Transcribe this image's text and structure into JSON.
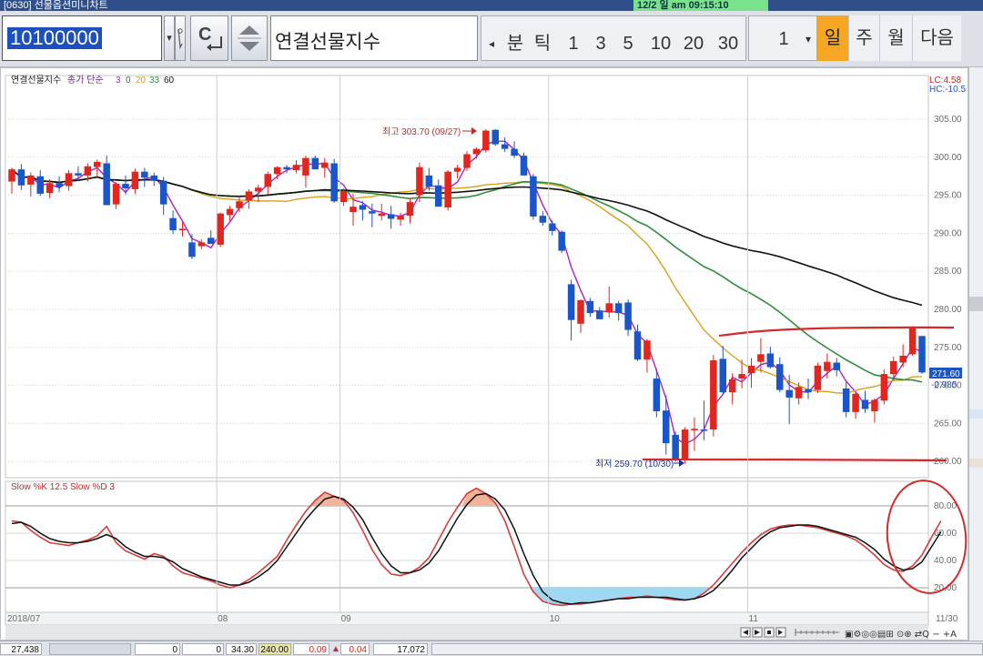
{
  "window": {
    "title": "[0630] 선물옵션미니차트",
    "alert": "12/2 일 am 09:15:10"
  },
  "toolbar": {
    "code": "10100000",
    "name": "연결선물지수",
    "periods": [
      "분",
      "틱",
      "1",
      "3",
      "5",
      "10",
      "20",
      "30"
    ],
    "count": "1",
    "tabs": [
      "일",
      "주",
      "월",
      "다음"
    ],
    "active_tab": "일"
  },
  "chart": {
    "header": {
      "symbol": "연결선물지수",
      "ma_label": "종가 단순",
      "ma_periods": [
        "3",
        "0",
        "20",
        "33",
        "60"
      ]
    },
    "side_info": [
      "LC:4.58",
      "HC:-10.5"
    ],
    "last_price": "271.60",
    "last_change": "-0.985",
    "high_note": "최고 303.70 (09/27)",
    "low_note": "최저 259.70 (10/30)",
    "osc_header": "Slow %K 12.5  Slow %D 3"
  },
  "chart_data": [
    {
      "type": "candlestick",
      "title": "연결선물지수",
      "yticks": [
        305,
        300,
        295,
        290,
        285,
        280,
        275,
        270,
        265,
        260
      ],
      "ylim": [
        259,
        307
      ],
      "x_labels": [
        "2018/07",
        "08",
        "09",
        "10",
        "11",
        "11/30"
      ],
      "ohlc": [
        [
          296.8,
          298.6,
          295.2,
          298.4
        ],
        [
          298.4,
          299.1,
          295.7,
          296.3
        ],
        [
          296.4,
          298.0,
          294.8,
          297.6
        ],
        [
          297.5,
          298.3,
          294.9,
          295.2
        ],
        [
          295.3,
          297.1,
          294.6,
          296.6
        ],
        [
          296.6,
          297.5,
          295.4,
          296.1
        ],
        [
          296.2,
          298.3,
          295.6,
          297.9
        ],
        [
          297.9,
          298.8,
          296.9,
          297.6
        ],
        [
          297.6,
          299.2,
          296.8,
          298.8
        ],
        [
          298.7,
          299.7,
          297.4,
          299.4
        ],
        [
          299.2,
          300.2,
          298.4,
          293.7
        ],
        [
          293.8,
          296.7,
          293.2,
          296.5
        ],
        [
          296.5,
          297.6,
          295.1,
          295.9
        ],
        [
          295.8,
          298.5,
          295.2,
          298.1
        ],
        [
          298.1,
          298.6,
          296.1,
          297.3
        ],
        [
          297.6,
          298.0,
          296.2,
          296.9
        ],
        [
          296.9,
          297.4,
          292.4,
          293.8
        ],
        [
          292.0,
          293.0,
          289.9,
          290.4
        ],
        [
          290.4,
          291.5,
          289.6,
          290.6
        ],
        [
          288.8,
          289.9,
          286.6,
          286.9
        ],
        [
          288.3,
          289.2,
          287.9,
          288.8
        ],
        [
          289.4,
          290.4,
          288.7,
          288.6
        ],
        [
          288.5,
          292.7,
          288.2,
          292.6
        ],
        [
          292.4,
          293.6,
          291.6,
          293.2
        ],
        [
          293.3,
          295.0,
          292.8,
          294.2
        ],
        [
          294.3,
          295.8,
          293.2,
          295.5
        ],
        [
          295.5,
          296.4,
          294.1,
          296.0
        ],
        [
          296.1,
          298.1,
          295.1,
          297.8
        ],
        [
          297.8,
          298.8,
          297.1,
          298.7
        ],
        [
          298.7,
          299.0,
          297.9,
          298.4
        ],
        [
          298.3,
          299.6,
          297.9,
          299.0
        ],
        [
          297.6,
          300.2,
          296.0,
          299.9
        ],
        [
          299.9,
          300.2,
          298.4,
          298.4
        ],
        [
          298.6,
          299.9,
          297.3,
          299.3
        ],
        [
          299.2,
          299.8,
          294.0,
          294.2
        ],
        [
          294.1,
          295.9,
          293.6,
          295.5
        ],
        [
          292.8,
          295.2,
          291.0,
          293.5
        ],
        [
          293.7,
          294.2,
          291.7,
          293.1
        ],
        [
          292.9,
          293.9,
          290.8,
          292.6
        ],
        [
          292.3,
          293.9,
          291.7,
          292.6
        ],
        [
          292.5,
          293.6,
          290.6,
          291.9
        ],
        [
          291.8,
          292.7,
          291.0,
          292.3
        ],
        [
          292.3,
          294.6,
          291.3,
          294.1
        ],
        [
          295.0,
          299.3,
          294.1,
          298.7
        ],
        [
          297.6,
          298.6,
          295.6,
          296.1
        ],
        [
          296.3,
          297.1,
          293.5,
          293.5
        ],
        [
          293.4,
          298.3,
          293.0,
          298.1
        ],
        [
          298.1,
          299.0,
          297.2,
          298.6
        ],
        [
          298.6,
          300.8,
          298.2,
          300.4
        ],
        [
          300.4,
          301.3,
          299.8,
          301.1
        ],
        [
          300.9,
          303.7,
          300.6,
          303.5
        ],
        [
          303.6,
          303.7,
          301.5,
          301.7
        ],
        [
          301.7,
          302.6,
          300.7,
          301.1
        ],
        [
          301.1,
          302.1,
          299.9,
          300.2
        ],
        [
          300.2,
          300.6,
          297.6,
          297.6
        ],
        [
          297.5,
          297.8,
          291.8,
          292.2
        ],
        [
          292.3,
          292.9,
          291.0,
          291.4
        ],
        [
          291.3,
          291.7,
          289.7,
          290.3
        ],
        [
          290.2,
          290.4,
          287.4,
          287.7
        ],
        [
          283.3,
          283.9,
          275.9,
          278.6
        ],
        [
          278.1,
          281.3,
          276.9,
          281.2
        ],
        [
          281.1,
          281.5,
          279.0,
          279.5
        ],
        [
          279.8,
          280.3,
          278.7,
          278.7
        ],
        [
          279.6,
          283.0,
          278.9,
          280.8
        ],
        [
          280.8,
          281.1,
          278.5,
          279.5
        ],
        [
          280.9,
          281.3,
          276.5,
          277.3
        ],
        [
          277.1,
          278.0,
          273.2,
          273.4
        ],
        [
          273.4,
          276.1,
          271.7,
          275.9
        ],
        [
          270.9,
          272.2,
          265.8,
          266.6
        ],
        [
          266.7,
          268.7,
          260.9,
          262.4
        ],
        [
          263.5,
          263.9,
          260.0,
          260.3
        ],
        [
          260.3,
          264.5,
          259.7,
          264.2
        ],
        [
          264.1,
          265.8,
          261.4,
          264.3
        ],
        [
          264.2,
          268.0,
          262.8,
          264.1
        ],
        [
          264.2,
          274.0,
          263.3,
          273.3
        ],
        [
          273.5,
          275.2,
          268.9,
          269.1
        ],
        [
          269.1,
          271.6,
          267.5,
          270.8
        ],
        [
          270.9,
          273.4,
          269.6,
          271.5
        ],
        [
          271.6,
          273.6,
          269.7,
          272.6
        ],
        [
          273.1,
          276.2,
          271.7,
          274.1
        ],
        [
          274.2,
          275.1,
          272.2,
          272.4
        ],
        [
          272.8,
          273.7,
          269.1,
          269.4
        ],
        [
          269.4,
          271.4,
          264.9,
          268.4
        ],
        [
          268.3,
          270.4,
          267.5,
          269.8
        ],
        [
          269.5,
          270.9,
          268.2,
          269.1
        ],
        [
          269.4,
          273.0,
          269.0,
          272.6
        ],
        [
          271.9,
          274.2,
          270.9,
          273.1
        ],
        [
          273.0,
          273.6,
          271.2,
          272.0
        ],
        [
          269.6,
          270.5,
          265.8,
          266.5
        ],
        [
          266.5,
          269.1,
          265.6,
          268.9
        ],
        [
          268.1,
          269.3,
          266.4,
          266.9
        ],
        [
          266.6,
          268.3,
          265.1,
          268.1
        ],
        [
          268.0,
          272.1,
          267.5,
          271.5
        ],
        [
          271.5,
          273.8,
          270.7,
          273.2
        ],
        [
          273.0,
          275.4,
          272.4,
          273.9
        ],
        [
          274.1,
          277.8,
          273.9,
          277.7
        ],
        [
          276.5,
          275.4,
          271.5,
          271.7
        ]
      ],
      "ma": [
        {
          "name": "3",
          "color": "#b021c0"
        },
        {
          "name": "20",
          "color": "#d8a118"
        },
        {
          "name": "33",
          "color": "#2d8f3c"
        },
        {
          "name": "60",
          "color": "#101010"
        }
      ]
    },
    {
      "type": "line",
      "title": "Slow %K 12.5  Slow %D 3",
      "yticks": [
        80,
        60,
        40,
        20
      ],
      "ylim": [
        0,
        100
      ],
      "series": [
        {
          "name": "Slow %K",
          "color": "#d83c3c",
          "values": [
            69,
            68,
            62,
            57,
            53,
            52,
            51,
            53,
            55,
            58,
            65,
            53,
            47,
            44,
            41,
            45,
            43,
            36,
            31,
            29,
            27,
            25,
            22,
            20,
            22,
            26,
            31,
            37,
            43,
            55,
            66,
            76,
            84,
            90,
            87,
            84,
            75,
            62,
            48,
            37,
            30,
            29,
            31,
            35,
            42,
            55,
            68,
            79,
            89,
            93,
            89,
            82,
            69,
            50,
            30,
            17,
            10,
            8,
            7,
            8,
            8,
            9,
            10,
            11,
            12,
            13,
            13,
            14,
            13,
            12,
            11,
            11,
            12,
            16,
            22,
            30,
            38,
            46,
            53,
            59,
            63,
            65,
            66,
            66,
            65,
            64,
            62,
            60,
            58,
            55,
            50,
            44,
            37,
            33,
            32,
            36,
            44,
            57,
            69
          ]
        },
        {
          "name": "Slow %D",
          "color": "#101010",
          "values": [
            67,
            68,
            65,
            60,
            56,
            54,
            53,
            53,
            54,
            56,
            59,
            56,
            50,
            46,
            43,
            43,
            42,
            39,
            34,
            31,
            28,
            26,
            24,
            22,
            22,
            24,
            28,
            33,
            40,
            50,
            60,
            70,
            78,
            85,
            87,
            85,
            79,
            70,
            57,
            45,
            36,
            31,
            31,
            33,
            38,
            47,
            59,
            71,
            81,
            88,
            89,
            85,
            77,
            63,
            45,
            29,
            17,
            11,
            9,
            8,
            9,
            9,
            10,
            11,
            12,
            12,
            13,
            13,
            13,
            13,
            12,
            11,
            12,
            14,
            18,
            25,
            33,
            42,
            49,
            56,
            61,
            64,
            65,
            66,
            66,
            65,
            63,
            61,
            59,
            57,
            53,
            48,
            41,
            36,
            33,
            34,
            39,
            50,
            61
          ]
        }
      ]
    }
  ],
  "status_bar": {
    "fields": [
      "27,438",
      "0",
      "0",
      "34.30",
      "240.00",
      "0.09",
      "0.04",
      "17,072"
    ]
  }
}
